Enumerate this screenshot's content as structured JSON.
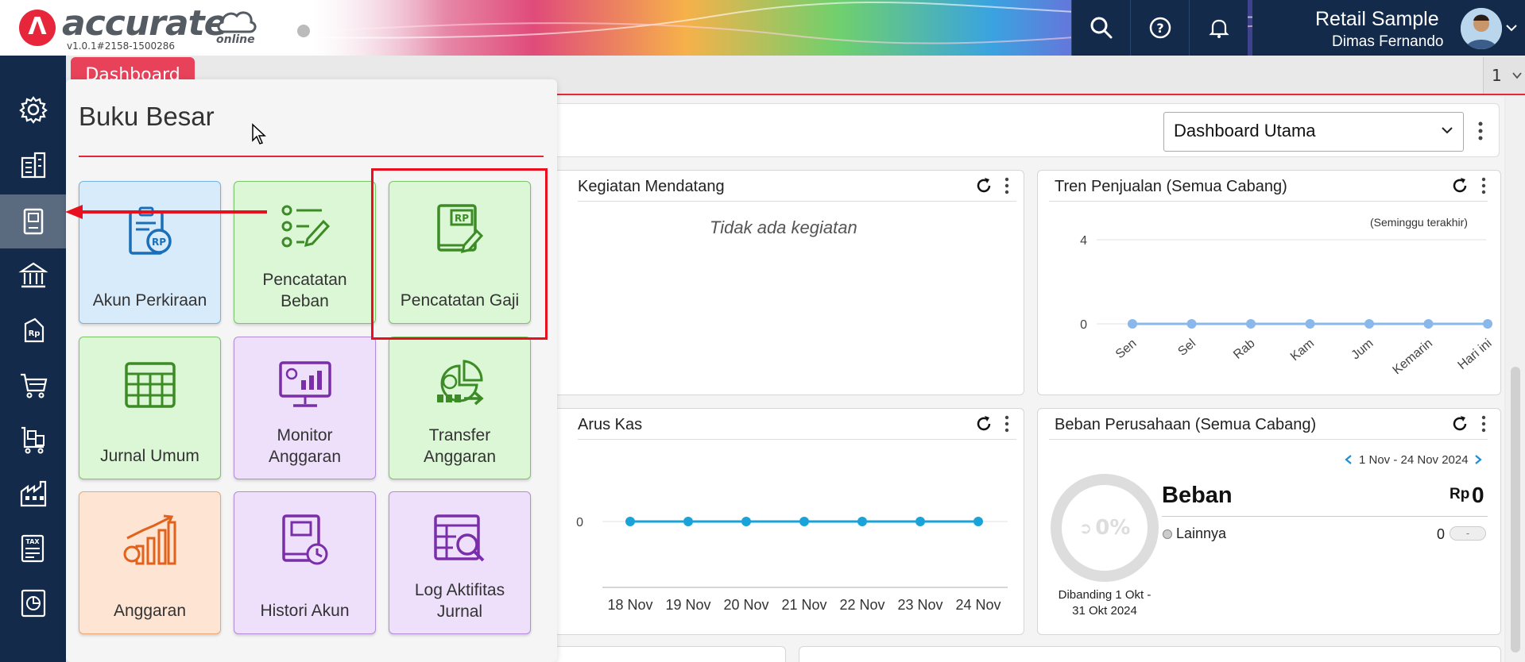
{
  "app": {
    "brand": "accurate",
    "brand_suffix": "online",
    "version": "v1.0.1#2158-1500286",
    "logo_letter": "Λ"
  },
  "header": {
    "company": "Retail Sample",
    "user": "Dimas Fernando",
    "icons": [
      "search-icon",
      "help-icon",
      "bell-icon"
    ]
  },
  "sidebar": {
    "items": [
      {
        "icon": "gear-icon"
      },
      {
        "icon": "building-icon"
      },
      {
        "icon": "ledger-book-icon",
        "active": true
      },
      {
        "icon": "bank-icon"
      },
      {
        "icon": "price-tag-rp-icon"
      },
      {
        "icon": "cart-icon"
      },
      {
        "icon": "warehouse-cart-icon"
      },
      {
        "icon": "factory-icon"
      },
      {
        "icon": "tax-document-icon"
      },
      {
        "icon": "report-chart-icon"
      }
    ]
  },
  "tabs": {
    "active": "Dashboard",
    "count": "1"
  },
  "dashboard": {
    "selected": "Dashboard Utama"
  },
  "cards": {
    "kegiatan": {
      "title": "Kegiatan Mendatang",
      "empty": "Tidak ada kegiatan"
    },
    "tren": {
      "title": "Tren Penjualan (Semua Cabang)",
      "period": "(Seminggu terakhir)"
    },
    "arus": {
      "title": "Arus Kas"
    },
    "beban": {
      "title": "Beban Perusahaan (Semua Cabang)",
      "period": "1 Nov - 24 Nov 2024",
      "donut_label": "0%",
      "heading": "Beban",
      "currency": "Rp",
      "total": "0",
      "legend_label": "Lainnya",
      "legend_value": "0",
      "legend_pill": "-",
      "compare": "Dibanding 1 Okt - 31 Okt 2024"
    }
  },
  "menu": {
    "title": "Buku Besar",
    "tiles": [
      {
        "label": "Akun Perkiraan",
        "icon": "account-rp-icon"
      },
      {
        "label": "Pencatatan Beban",
        "icon": "expense-checklist-icon"
      },
      {
        "label": "Pencatatan Gaji",
        "icon": "payroll-book-icon"
      },
      {
        "label": "Jurnal Umum",
        "icon": "journal-table-icon"
      },
      {
        "label": "Monitor Anggaran",
        "icon": "budget-monitor-icon"
      },
      {
        "label": "Transfer Anggaran",
        "icon": "budget-transfer-icon"
      },
      {
        "label": "Anggaran",
        "icon": "budget-growth-icon"
      },
      {
        "label": "Histori Akun",
        "icon": "account-history-icon"
      },
      {
        "label": "Log Aktifitas Jurnal",
        "icon": "journal-log-icon"
      }
    ]
  },
  "chart_data": [
    {
      "type": "line",
      "title": "Tren Penjualan (Semua Cabang)",
      "subtitle": "(Seminggu terakhir)",
      "categories": [
        "Sen",
        "Sel",
        "Rab",
        "Kam",
        "Jum",
        "Kemarin",
        "Hari ini"
      ],
      "values": [
        0,
        0,
        0,
        0,
        0,
        0,
        0
      ],
      "y_ticks": [
        0,
        4
      ],
      "ylim": [
        0,
        4
      ]
    },
    {
      "type": "line",
      "title": "Arus Kas",
      "categories": [
        "18 Nov",
        "19 Nov",
        "20 Nov",
        "21 Nov",
        "22 Nov",
        "23 Nov",
        "24 Nov"
      ],
      "values": [
        0,
        0,
        0,
        0,
        0,
        0,
        0
      ],
      "y_ticks": [
        0
      ]
    },
    {
      "type": "pie",
      "title": "Beban Perusahaan (Semua Cabang)",
      "categories": [
        "Lainnya"
      ],
      "values": [
        0
      ]
    }
  ],
  "colors": {
    "brand_red": "#e8263b",
    "nav_dark": "#132a4b",
    "tren_line": "#8ab8ea",
    "arus_line": "#1aa3d9"
  }
}
